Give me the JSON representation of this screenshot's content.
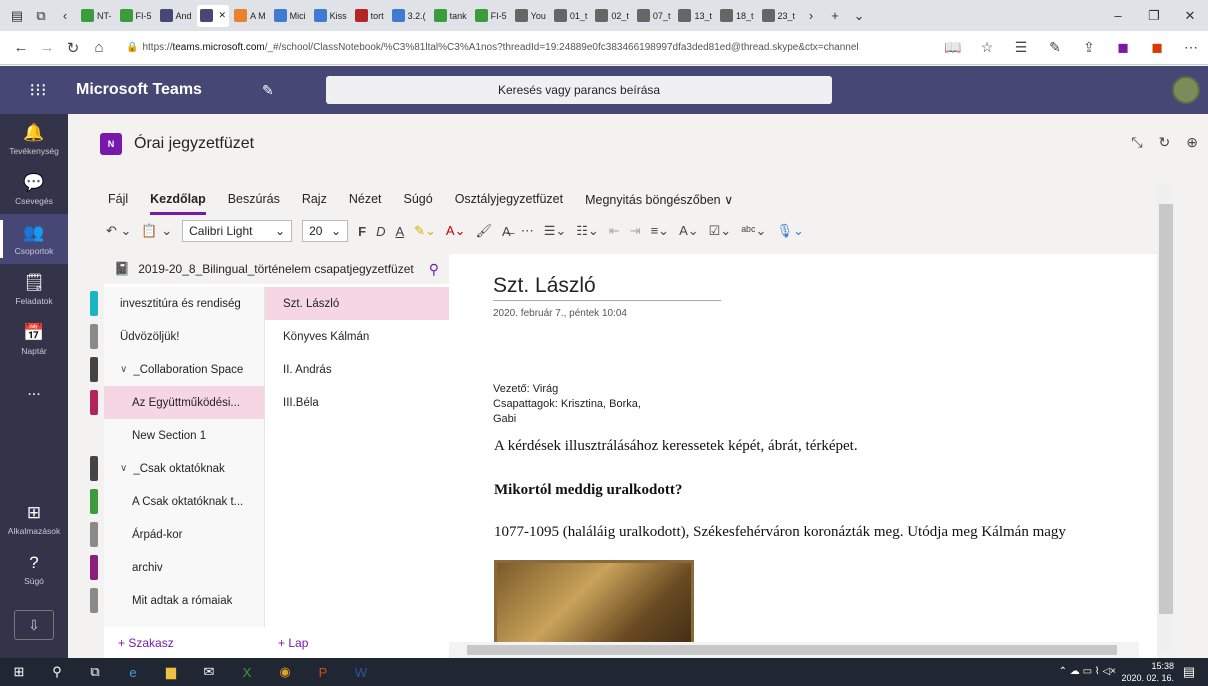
{
  "browser": {
    "tabs": [
      {
        "label": "NT-",
        "color": "#3c9b3c"
      },
      {
        "label": "FI-5",
        "color": "#3c9b3c"
      },
      {
        "label": "And",
        "color": "#464775"
      },
      {
        "label": "",
        "color": "#464775",
        "active": true
      },
      {
        "label": "A M",
        "color": "#e8822d"
      },
      {
        "label": "Mici",
        "color": "#3f7bd1"
      },
      {
        "label": "Kiss",
        "color": "#3f7bd1"
      },
      {
        "label": "tort",
        "color": "#b42525"
      },
      {
        "label": "3.2.(",
        "color": "#3f7bd1"
      },
      {
        "label": "tank",
        "color": "#3c9b3c"
      },
      {
        "label": "FI-5",
        "color": "#3c9b3c"
      },
      {
        "label": "You",
        "color": "#666666"
      },
      {
        "label": "01_t",
        "color": "#666666"
      },
      {
        "label": "02_t",
        "color": "#666666"
      },
      {
        "label": "07_t",
        "color": "#666666"
      },
      {
        "label": "13_t",
        "color": "#666666"
      },
      {
        "label": "18_t",
        "color": "#666666"
      },
      {
        "label": "23_t",
        "color": "#666666"
      }
    ],
    "url_prefix": "https://",
    "url_host": "teams.microsoft.com",
    "url_path": "/_#/school/ClassNotebook/%C3%81ltal%C3%A1nos?threadId=19:24889e0fc383466198997dfa3ded81ed@thread.skype&ctx=channel"
  },
  "teams": {
    "app_title": "Microsoft Teams",
    "search_placeholder": "Keresés vagy parancs beírása"
  },
  "rail": {
    "items": [
      {
        "label": "Tevékenység",
        "icon": "bell-icon",
        "glyph": "🔔"
      },
      {
        "label": "Csevegés",
        "icon": "chat-icon",
        "glyph": "💬"
      },
      {
        "label": "Csoportok",
        "icon": "teams-icon",
        "glyph": "👥",
        "selected": true
      },
      {
        "label": "Feladatok",
        "icon": "assignments-icon",
        "glyph": "🗒"
      },
      {
        "label": "Naptár",
        "icon": "calendar-icon",
        "glyph": "📅"
      },
      {
        "label": "...",
        "icon": "more-icon",
        "glyph": ""
      }
    ],
    "bottom": [
      {
        "label": "Alkalmazások",
        "icon": "apps-icon",
        "glyph": "⊞"
      },
      {
        "label": "Súgó",
        "icon": "help-icon",
        "glyph": "?"
      }
    ]
  },
  "notebook": {
    "header_title": "Órai jegyzetfüzet",
    "logo_text": "N",
    "name": "2019-20_8_Bilingual_történelem csapatjegyzetfüzet",
    "menu_tabs": [
      "Fájl",
      "Kezdőlap",
      "Beszúrás",
      "Rajz",
      "Nézet",
      "Súgó",
      "Osztályjegyzetfüzet",
      "Megnyitás böngészőben ∨"
    ],
    "selected_tab": "Kezdőlap",
    "font_name": "Calibri Light",
    "font_size": "20",
    "sections": [
      {
        "label": "invesztitúra és rendiség",
        "color": "#19b5c0",
        "indent": false
      },
      {
        "label": "Üdvözöljük!",
        "color": "#8a8a8a",
        "indent": false
      },
      {
        "label": "_Collaboration Space",
        "color": "#444444",
        "indent": false,
        "group": true
      },
      {
        "label": "Az Együttműködési...",
        "color": "#b4245c",
        "indent": true,
        "selected": true
      },
      {
        "label": "New Section 1",
        "color": "",
        "indent": true
      },
      {
        "label": "_Csak oktatóknak",
        "color": "#444444",
        "indent": false,
        "group": true
      },
      {
        "label": "A Csak oktatóknak t...",
        "color": "#3c9b3c",
        "indent": true
      },
      {
        "label": "Árpád-kor",
        "color": "#8a8a8a",
        "indent": true
      },
      {
        "label": "archiv",
        "color": "#8a1e7a",
        "indent": true
      },
      {
        "label": "Mit adtak a rómaiak",
        "color": "#8a8a8a",
        "indent": true
      }
    ],
    "pages": [
      {
        "label": "Szt. László",
        "selected": true
      },
      {
        "label": "Könyves Kálmán"
      },
      {
        "label": "II. András"
      },
      {
        "label": "III.Béla"
      }
    ],
    "add_section": "+ Szakasz",
    "add_page": "+ Lap"
  },
  "page": {
    "title": "Szt. László",
    "date": "2020. február 7., péntek   10:04",
    "leader_line1": "Vezető: Virág",
    "leader_line2": "Csapattagok: Krisztina, Borka,",
    "leader_line3": "Gabi",
    "para1": "A kérdések illusztrálásához keressetek képét, ábrát, térképet.",
    "heading": "Mikortól meddig uralkodott?",
    "para2": "1077-1095 (haláláig uralkodott), Székesfehérváron koronázták meg. Utódja meg Kálmán magy"
  },
  "taskbar": {
    "time": "15:38",
    "date": "2020. 02. 16."
  }
}
